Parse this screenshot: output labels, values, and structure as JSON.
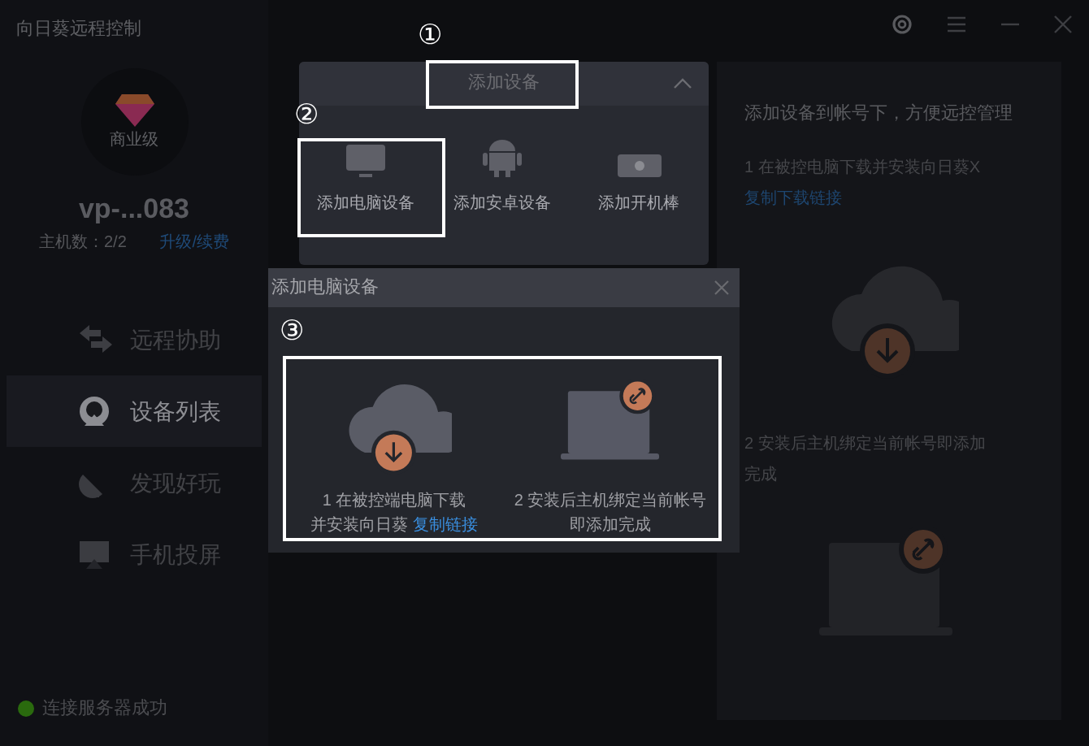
{
  "window": {
    "title": "向日葵远程控制"
  },
  "account": {
    "badge": "商业级",
    "name": "vp-...083",
    "hosts": "主机数：2/2",
    "upgrade_link": "升级/续费"
  },
  "nav": [
    {
      "label": "远程协助",
      "kind": "remote",
      "selected": false
    },
    {
      "label": "设备列表",
      "kind": "devices",
      "selected": true
    },
    {
      "label": "发现好玩",
      "kind": "discover",
      "selected": false
    },
    {
      "label": "手机投屏",
      "kind": "cast",
      "selected": false
    }
  ],
  "status": {
    "text": "连接服务器成功",
    "connected": true
  },
  "guide": {
    "title": "添加设备到帐号下，方便远控管理",
    "step1": "1 在被控电脑下载并安装向日葵X",
    "step1_link": "复制下载链接",
    "step2": "2 安装后主机绑定当前帐号即添加完成"
  },
  "add_panel": {
    "title": "添加设备",
    "expanded": true,
    "options": [
      {
        "label": "添加电脑设备",
        "kind": "pc"
      },
      {
        "label": "添加安卓设备",
        "kind": "android"
      },
      {
        "label": "添加开机棒",
        "kind": "stick"
      }
    ]
  },
  "dialog": {
    "title": "添加电脑设备",
    "steps": [
      {
        "kind": "download",
        "lines": [
          "1 在被控端电脑下载",
          "并安装向日葵"
        ],
        "link": "复制链接"
      },
      {
        "kind": "bind",
        "lines": [
          "2 安装后主机绑定当前帐号",
          "即添加完成"
        ]
      }
    ]
  },
  "markers": [
    "①",
    "②",
    "③"
  ]
}
